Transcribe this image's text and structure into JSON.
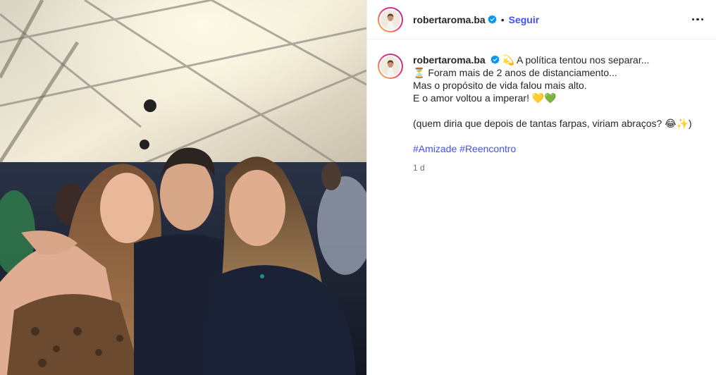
{
  "post": {
    "username": "robertaroma.ba",
    "follow_label": "Seguir",
    "separator": "•",
    "caption": {
      "line1": "💫 A política tentou nos separar...",
      "line2": "⏳ Foram mais de 2 anos de distanciamento...",
      "line3": "Mas o propósito de vida falou mais alto.",
      "line4": "E o amor voltou a imperar! 💛💚",
      "line5": "(quem diria que depois de tantas farpas, viriam abraços? 😂✨)",
      "hashtag1": "#Amizade",
      "hashtag2": "#Reencontro"
    },
    "timestamp": "1 d"
  },
  "colors": {
    "link": "#4150f7",
    "verified": "#0095f6",
    "text": "#262626",
    "muted": "#737373"
  },
  "icons": {
    "verified": "verified-badge-icon",
    "more": "more-options-icon"
  }
}
